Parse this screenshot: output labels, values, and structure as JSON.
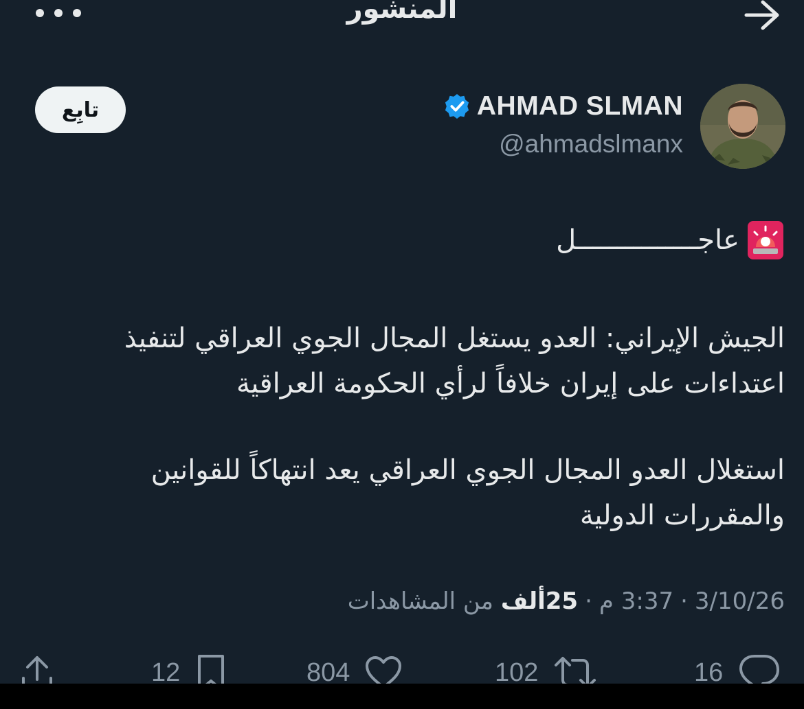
{
  "header": {
    "title": "المنشور"
  },
  "author": {
    "display_name": "AHMAD SLMAN",
    "handle": "@ahmadslmanx",
    "follow_label": "تابِع"
  },
  "post": {
    "urgent": "عاجـــــــــــــــل",
    "paragraph1_line1": "الجيش الإيراني: العدو يستغل المجال الجوي العراقي لتنفيذ",
    "paragraph1_line2": "اعتداءات على إيران خلافاً لرأي الحكومة العراقية",
    "paragraph2_line1": "استغلال العدو المجال الجوي العراقي يعد انتهاكاً للقوانين",
    "paragraph2_line2": "والمقررات الدولية"
  },
  "meta": {
    "date": "3/10/26",
    "time": "3:37 م",
    "views_count": "25ألف",
    "views_label": "من المشاهدات"
  },
  "actions": {
    "replies": "16",
    "reposts": "102",
    "likes": "804",
    "bookmarks": "12"
  },
  "colors": {
    "background": "#15202b",
    "verified": "#1d9bf0",
    "secondary_text": "#8b98a5",
    "follow_bg": "#eff3f4"
  },
  "icons": [
    "more-icon",
    "back-arrow-icon",
    "verified-icon",
    "siren-icon",
    "reply-icon",
    "repost-icon",
    "like-icon",
    "bookmark-icon",
    "share-icon"
  ]
}
